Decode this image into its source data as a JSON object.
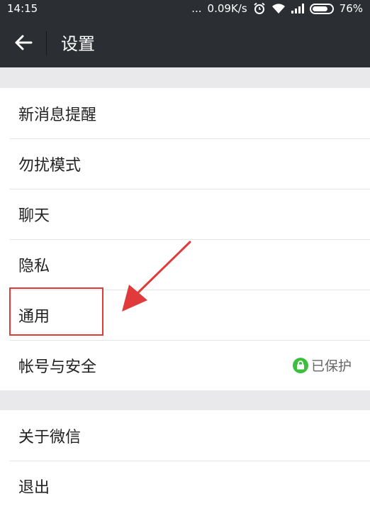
{
  "status_bar": {
    "time": "14:15",
    "dots": "...",
    "net_speed": "0.09K/s",
    "battery": "76%",
    "icons": [
      "alarm-icon",
      "wifi-icon",
      "signal-icon",
      "battery-icon"
    ]
  },
  "header": {
    "title": "设置",
    "back_icon": "back-arrow-icon"
  },
  "settings": {
    "group1": [
      {
        "label": "新消息提醒"
      },
      {
        "label": "勿扰模式"
      },
      {
        "label": "聊天"
      },
      {
        "label": "隐私"
      },
      {
        "label": "通用"
      },
      {
        "label": "帐号与安全",
        "status": "已保护"
      }
    ],
    "group2": [
      {
        "label": "关于微信"
      },
      {
        "label": "退出"
      }
    ]
  },
  "colors": {
    "header_bg": "#2b2f33",
    "page_bg": "#e9e9ec",
    "annotation_red": "#e03a3a",
    "protect_green": "#3cbf3c"
  }
}
